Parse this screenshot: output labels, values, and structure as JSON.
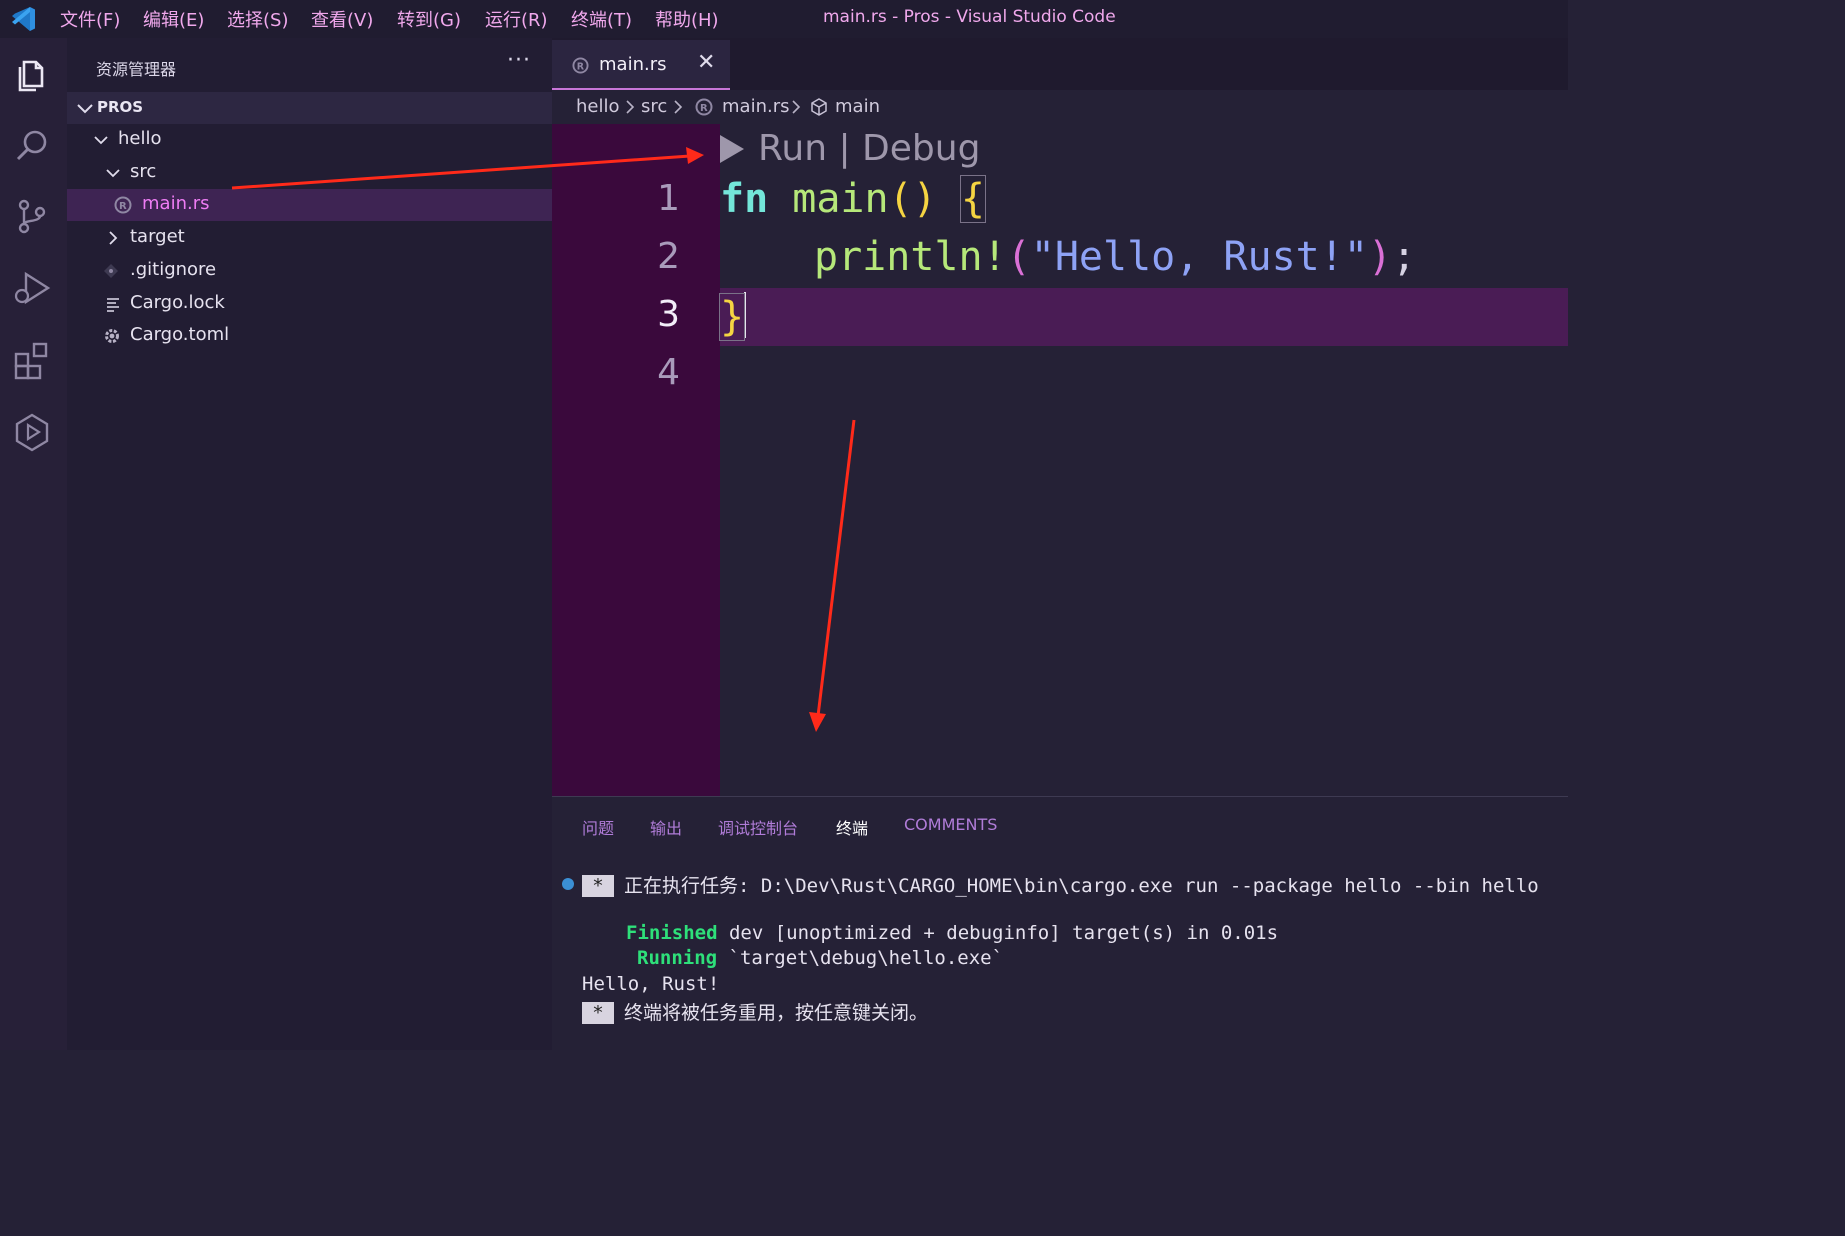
{
  "window": {
    "title": "main.rs - Pros - Visual Studio Code"
  },
  "menu": [
    "文件(F)",
    "编辑(E)",
    "选择(S)",
    "查看(V)",
    "转到(G)",
    "运行(R)",
    "终端(T)",
    "帮助(H)"
  ],
  "activity_bar": [
    "explorer-icon",
    "search-icon",
    "source-control-icon",
    "run-debug-icon",
    "extensions-icon",
    "remote-explorer-icon"
  ],
  "sidebar": {
    "title": "资源管理器",
    "more": "···",
    "section": "PROS",
    "tree": [
      {
        "label": "hello",
        "kind": "folder",
        "expanded": true
      },
      {
        "label": "src",
        "kind": "folder",
        "expanded": true
      },
      {
        "label": "main.rs",
        "kind": "rust-file",
        "selected": true
      },
      {
        "label": "target",
        "kind": "folder",
        "expanded": false
      },
      {
        "label": ".gitignore",
        "kind": "git-file"
      },
      {
        "label": "Cargo.lock",
        "kind": "lines-file"
      },
      {
        "label": "Cargo.toml",
        "kind": "gear-file"
      }
    ]
  },
  "editor": {
    "tab": {
      "label": "main.rs",
      "close": "✕"
    },
    "breadcrumbs": [
      "hello",
      "src",
      "main.rs",
      "main"
    ],
    "codelens": "Run | Debug",
    "line_numbers": [
      "1",
      "2",
      "3",
      "4"
    ],
    "active_line": 3,
    "code": {
      "line1_kw": "fn",
      "line1_name": "main",
      "line1_parens": "()",
      "line1_brace": "{",
      "line2_macro": "println!",
      "line2_open": "(",
      "line2_string": "\"Hello, Rust!\"",
      "line2_close": ")",
      "line2_semi": ";",
      "line3_brace": "}"
    }
  },
  "panel": {
    "tabs": [
      "问题",
      "输出",
      "调试控制台",
      "终端",
      "COMMENTS"
    ],
    "active_tab": "终端",
    "terminal": {
      "star": "*",
      "task_line": "正在执行任务: D:\\Dev\\Rust\\CARGO_HOME\\bin\\cargo.exe run --package hello --bin hello",
      "finished_word": "Finished",
      "finished_rest": " dev [unoptimized + debuginfo] target(s) in 0.01s",
      "running_word": "Running",
      "running_rest": " `target\\debug\\hello.exe`",
      "output": "Hello, Rust!",
      "reuse_line": "终端将被任务重用，按任意键关闭。"
    }
  },
  "colors": {
    "accent": "#ee7cf4",
    "gutter": "#3a093c",
    "annotation_arrow": "#ff2a1a"
  }
}
